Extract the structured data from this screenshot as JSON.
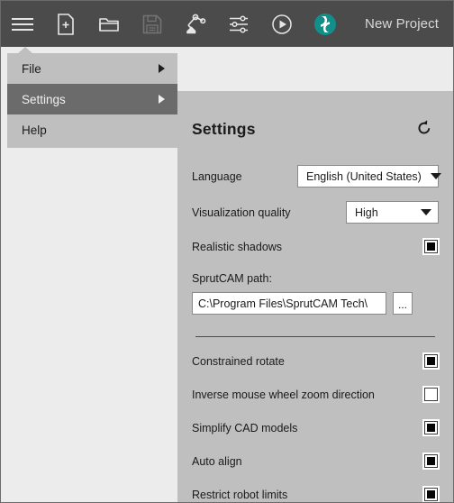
{
  "toolbar": {
    "items": [
      {
        "name": "hamburger-menu-icon",
        "label": "Menu"
      },
      {
        "name": "new-file-icon",
        "label": "New"
      },
      {
        "name": "open-folder-icon",
        "label": "Open"
      },
      {
        "name": "save-disk-icon",
        "label": "Save"
      },
      {
        "name": "robot-arm-icon",
        "label": "Robot"
      },
      {
        "name": "sliders-settings-icon",
        "label": "Settings"
      },
      {
        "name": "play-circle-icon",
        "label": "Play"
      }
    ],
    "logo_name": "sprutcam-logo-icon",
    "project_title": "New Project"
  },
  "menu": {
    "items": [
      {
        "label": "File",
        "has_submenu": true,
        "selected": false
      },
      {
        "label": "Settings",
        "has_submenu": true,
        "selected": true
      },
      {
        "label": "Help",
        "has_submenu": false,
        "selected": false
      }
    ]
  },
  "settings": {
    "title": "Settings",
    "reset_icon": "reset-arrow-icon",
    "language": {
      "label": "Language",
      "value": "English (United States)",
      "options": [
        "English (United States)"
      ]
    },
    "visualization_quality": {
      "label": "Visualization quality",
      "value": "High",
      "options": [
        "High"
      ]
    },
    "realistic_shadows": {
      "label": "Realistic shadows",
      "checked": true
    },
    "sprutcam_path": {
      "label": "SprutCAM path:",
      "value": "C:\\Program Files\\SprutCAM Tech\\",
      "browse_label": "..."
    },
    "options": [
      {
        "label": "Constrained rotate",
        "checked": true
      },
      {
        "label": "Inverse mouse wheel zoom direction",
        "checked": false
      },
      {
        "label": "Simplify CAD models",
        "checked": true
      },
      {
        "label": "Auto align",
        "checked": true
      },
      {
        "label": "Restrict robot limits",
        "checked": true
      }
    ]
  },
  "colors": {
    "toolbar_bg": "#4b4b4b",
    "panel_bg": "#bfbfbf",
    "app_bg": "#ececec",
    "selected_menu_bg": "#6b6b6b",
    "accent_teal": "#128f8b"
  }
}
